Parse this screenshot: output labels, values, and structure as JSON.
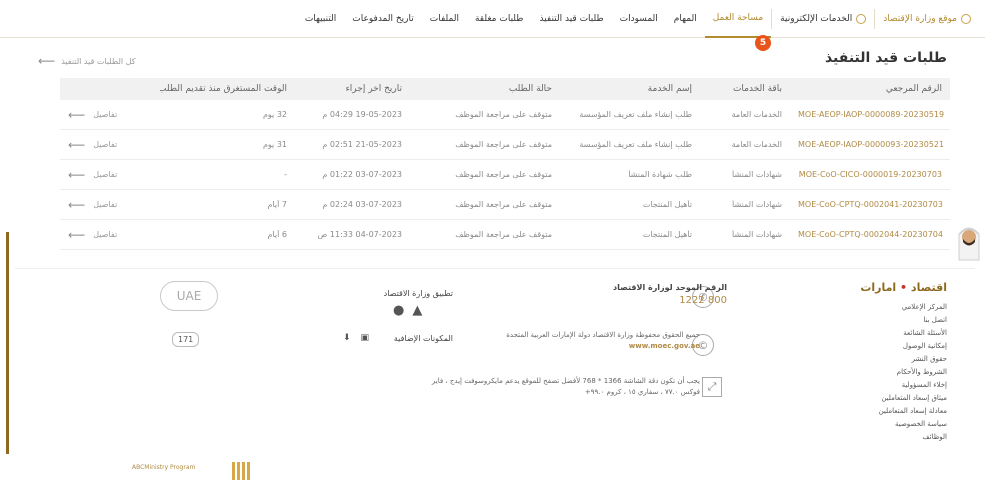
{
  "nav": {
    "items": [
      {
        "label": "موقع وزارة الإقتصاد",
        "icon": "globe-icon"
      },
      {
        "label": "الخدمات الإلكترونية",
        "icon": "services-icon"
      },
      {
        "label": "مساحة العمل"
      },
      {
        "label": "المهام"
      },
      {
        "label": "المسودات"
      },
      {
        "label": "طلبات قيد التنفيذ"
      },
      {
        "label": "طلبات مغلقة"
      },
      {
        "label": "الملفات"
      },
      {
        "label": "تاريخ المدفوعات"
      },
      {
        "label": "التنبيهات"
      }
    ],
    "badge_count": "5"
  },
  "page": {
    "title": "طلبات قيد التنفيذ",
    "back_label": "كل الطلبات قيد التنفيذ"
  },
  "table": {
    "headers": {
      "ref": "الرقم المرجعي",
      "package": "باقة الخدمات",
      "service": "إسم الخدمة",
      "status": "حالة الطلب",
      "last_action": "تاريخ آخر إجراء",
      "time": "الوقت المستغرق منذ تقديم الطلب (بالايام)"
    },
    "rows": [
      {
        "ref": "MOE-AEOP-IAOP-0000089-20230519",
        "package": "الخدمات العامة",
        "service": "طلب إنشاء ملف تعريف المؤسسة",
        "status": "متوقف على مراجعة الموظف",
        "last_action": "19-05-2023 04:29 م",
        "time": "32 يوم",
        "details": "تفاصيل"
      },
      {
        "ref": "MOE-AEOP-IAOP-0000093-20230521",
        "package": "الخدمات العامة",
        "service": "طلب إنشاء ملف تعريف المؤسسة",
        "status": "متوقف على مراجعة الموظف",
        "last_action": "21-05-2023 02:51 م",
        "time": "31 يوم",
        "details": "تفاصيل"
      },
      {
        "ref": "MOE-CoO-CICO-0000019-20230703",
        "package": "شهادات المنشأ",
        "service": "طلب شهادة المنشأ",
        "status": "متوقف على مراجعة الموظف",
        "last_action": "03-07-2023 01:22 م",
        "time": "-",
        "details": "تفاصيل"
      },
      {
        "ref": "MOE-CoO-CPTQ-0002041-20230703",
        "package": "شهادات المنشأ",
        "service": "تأهيل المنتجات",
        "status": "متوقف على مراجعة الموظف",
        "last_action": "03-07-2023 02:24 م",
        "time": "7 أيام",
        "details": "تفاصيل"
      },
      {
        "ref": "MOE-CoO-CPTQ-0002044-20230704",
        "package": "شهادات المنشأ",
        "service": "تأهيل المنتجات",
        "status": "متوقف على مراجعة الموظف",
        "last_action": "04-07-2023 11:33 ص",
        "time": "6 أيام",
        "details": "تفاصيل"
      }
    ]
  },
  "footer": {
    "brand_left": "اقتصاد",
    "brand_right": "امارات",
    "links": [
      "المركز الإعلامي",
      "اتصل بنا",
      "الأسئلة الشائعة",
      "إمكانية الوصول",
      "حقوق النشر",
      "الشروط والأحكام",
      "إخلاء المسؤولية",
      "ميثاق إسعاد المتعاملين",
      "معادلة إسعاد المتعاملين",
      "سياسة الخصوصية",
      "الوظائف"
    ],
    "contact_title": "الرقم الموحد لوزارة الاقتصاد",
    "contact_number": "800 1222",
    "copyright": "جميع الحقوق محفوظة وزارة الاقتصاد دولة الإمارات العربية المتحدة",
    "copyright_url": "www.moec.gov.ae",
    "resolution_note": "يجب أن تكون دقة الشاشة 1366 * 768 لأفضل تصفح للموقع يدعم مايكروسوفت إيدج ، فاير فوكس ٧٧.٠ ، سفاري ١٥ ، كروم ٩٩.٠+",
    "app_title": "تطبيق وزارة الاقتصاد",
    "addons_title": "المكونات الإضافية",
    "uae_logo": "UAE",
    "small_logo": "171",
    "bottom_logo_text": "ABCMinistry Program"
  }
}
